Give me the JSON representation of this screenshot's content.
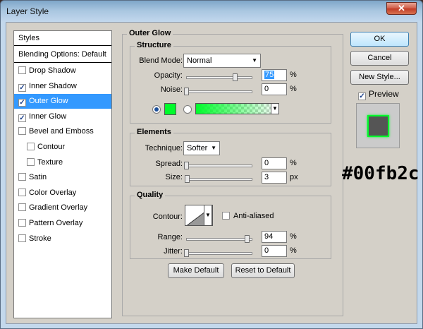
{
  "window": {
    "title": "Layer Style",
    "close_glyph": "✕"
  },
  "styles_list": {
    "header": "Styles",
    "blending": "Blending Options: Default",
    "items": [
      {
        "label": "Drop Shadow",
        "checked": false
      },
      {
        "label": "Inner Shadow",
        "checked": true
      },
      {
        "label": "Outer Glow",
        "checked": true,
        "selected": true
      },
      {
        "label": "Inner Glow",
        "checked": true
      },
      {
        "label": "Bevel and Emboss",
        "checked": false
      },
      {
        "label": "Contour",
        "checked": false,
        "sub": true
      },
      {
        "label": "Texture",
        "checked": false,
        "sub": true
      },
      {
        "label": "Satin",
        "checked": false
      },
      {
        "label": "Color Overlay",
        "checked": false
      },
      {
        "label": "Gradient Overlay",
        "checked": false
      },
      {
        "label": "Pattern Overlay",
        "checked": false
      },
      {
        "label": "Stroke",
        "checked": false
      }
    ]
  },
  "outer_glow": {
    "title": "Outer Glow",
    "structure": {
      "title": "Structure",
      "blend_mode_label": "Blend Mode:",
      "blend_mode_value": "Normal",
      "opacity_label": "Opacity:",
      "opacity_value": "75",
      "opacity_fraction": 0.75,
      "noise_label": "Noise:",
      "noise_value": "0",
      "noise_fraction": 0.0,
      "percent": "%",
      "color": "#00fb2c"
    },
    "elements": {
      "title": "Elements",
      "technique_label": "Technique:",
      "technique_value": "Softer",
      "spread_label": "Spread:",
      "spread_value": "0",
      "spread_fraction": 0.0,
      "size_label": "Size:",
      "size_value": "3",
      "size_fraction": 0.012,
      "percent": "%",
      "px": "px"
    },
    "quality": {
      "title": "Quality",
      "contour_label": "Contour:",
      "anti_aliased_label": "Anti-aliased",
      "range_label": "Range:",
      "range_value": "94",
      "range_fraction": 0.94,
      "jitter_label": "Jitter:",
      "jitter_value": "0",
      "jitter_fraction": 0.0,
      "percent": "%"
    },
    "make_default": "Make Default",
    "reset_default": "Reset to Default"
  },
  "buttons": {
    "ok": "OK",
    "cancel": "Cancel",
    "new_style": "New Style...",
    "preview_label": "Preview",
    "preview_checked": true
  },
  "annotation": {
    "hex": "#00fb2c"
  }
}
